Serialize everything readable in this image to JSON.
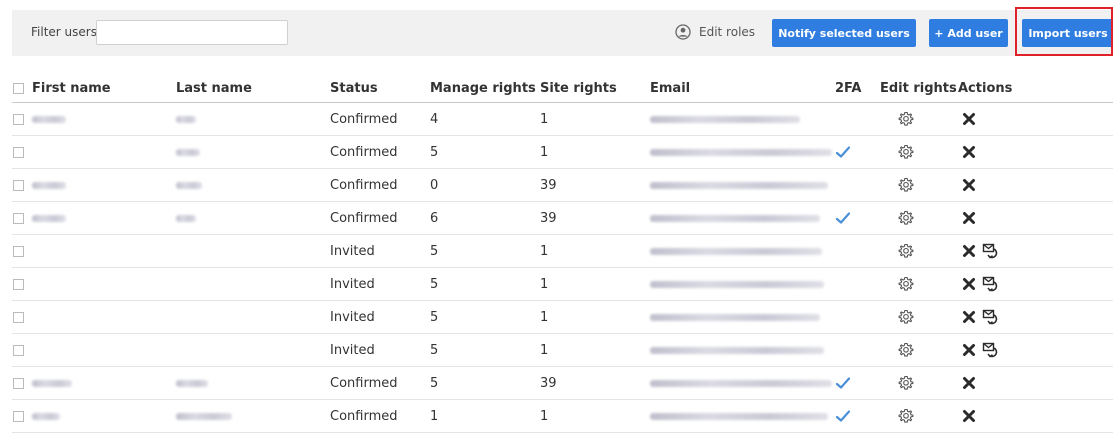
{
  "toolbar": {
    "filter_label": "Filter users:",
    "filter_value": "",
    "edit_roles_label": "Edit roles",
    "notify_label": "Notify selected users",
    "add_label": "+ Add user",
    "import_label": "Import users"
  },
  "columns": {
    "first_name": "First name",
    "last_name": "Last name",
    "status": "Status",
    "manage_rights": "Manage rights",
    "site_rights": "Site rights",
    "email": "Email",
    "twofa": "2FA",
    "edit_rights": "Edit rights",
    "actions": "Actions"
  },
  "rows": [
    {
      "status": "Confirmed",
      "manage_rights": "4",
      "site_rights": "1",
      "twofa": false,
      "resend": false
    },
    {
      "status": "Confirmed",
      "manage_rights": "5",
      "site_rights": "1",
      "twofa": true,
      "resend": false
    },
    {
      "status": "Confirmed",
      "manage_rights": "0",
      "site_rights": "39",
      "twofa": false,
      "resend": false
    },
    {
      "status": "Confirmed",
      "manage_rights": "6",
      "site_rights": "39",
      "twofa": true,
      "resend": false
    },
    {
      "status": "Invited",
      "manage_rights": "5",
      "site_rights": "1",
      "twofa": false,
      "resend": true
    },
    {
      "status": "Invited",
      "manage_rights": "5",
      "site_rights": "1",
      "twofa": false,
      "resend": true
    },
    {
      "status": "Invited",
      "manage_rights": "5",
      "site_rights": "1",
      "twofa": false,
      "resend": true
    },
    {
      "status": "Invited",
      "manage_rights": "5",
      "site_rights": "1",
      "twofa": false,
      "resend": true
    },
    {
      "status": "Confirmed",
      "manage_rights": "5",
      "site_rights": "39",
      "twofa": true,
      "resend": false
    },
    {
      "status": "Confirmed",
      "manage_rights": "1",
      "site_rights": "1",
      "twofa": true,
      "resend": false
    }
  ],
  "colors": {
    "button_blue": "#2f7de1",
    "highlight_red": "#e0202a",
    "check_blue": "#4a8fd8"
  },
  "icons": {
    "edit_roles": "user-circle-icon",
    "edit_rights": "gear-icon",
    "delete": "x-icon",
    "resend": "envelope-resend-icon",
    "twofa": "checkmark-icon"
  }
}
